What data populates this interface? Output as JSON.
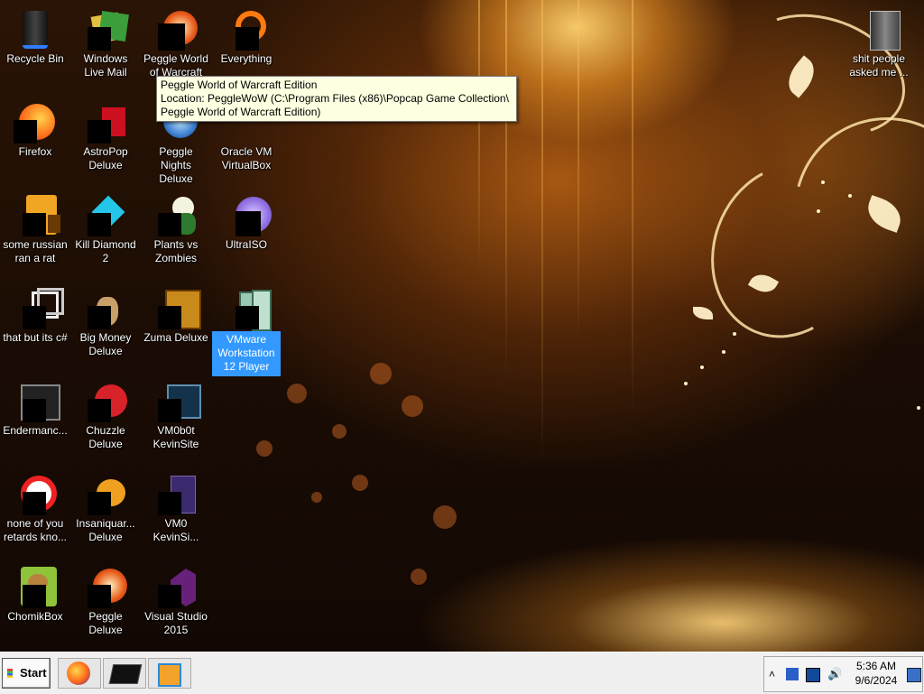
{
  "desktop_icons": [
    {
      "label": "Recycle Bin"
    },
    {
      "label": "Windows Live Mail"
    },
    {
      "label": "Peggle World of Warcraft"
    },
    {
      "label": "Everything"
    },
    {
      "label": "Firefox"
    },
    {
      "label": "AstroPop Deluxe"
    },
    {
      "label": "Peggle Nights Deluxe"
    },
    {
      "label": "Oracle VM VirtualBox"
    },
    {
      "label": "some russian ran a rat"
    },
    {
      "label": "Kill Diamond 2"
    },
    {
      "label": "Plants vs Zombies"
    },
    {
      "label": "UltraISO"
    },
    {
      "label": "that but its c#"
    },
    {
      "label": "Big Money Deluxe"
    },
    {
      "label": "Zuma Deluxe"
    },
    {
      "label": "VMware Workstation 12 Player"
    },
    {
      "label": "Endermanc..."
    },
    {
      "label": "Chuzzle Deluxe"
    },
    {
      "label": "VM0b0t KevinSite"
    },
    {
      "label": "none of you retards kno..."
    },
    {
      "label": "Insaniquar... Deluxe"
    },
    {
      "label": "VM0 KevinSi..."
    },
    {
      "label": "ChomikBox"
    },
    {
      "label": "Peggle Deluxe"
    },
    {
      "label": "Visual Studio 2015"
    },
    {
      "label": "shit people asked me ..."
    }
  ],
  "tooltip": {
    "line1": "Peggle World of Warcraft Edition",
    "line2": "Location: PeggleWoW (C:\\Program Files (x86)\\Popcap Game Collection\\",
    "line3": "Peggle World of Warcraft Edition)"
  },
  "taskbar": {
    "start_label": "Start",
    "clock_time": "5:36 AM",
    "clock_date": "9/6/2024"
  }
}
